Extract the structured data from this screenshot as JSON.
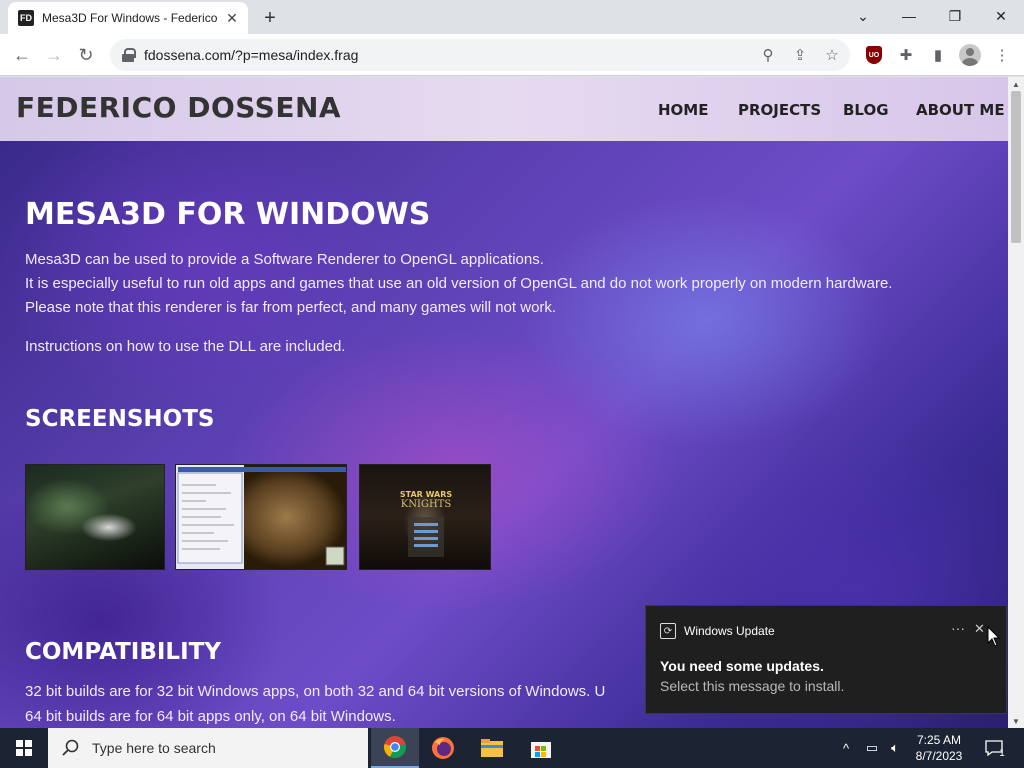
{
  "browser": {
    "tab_title": "Mesa3D For Windows - Federico",
    "favicon_text": "FD",
    "url": "fdossena.com/?p=mesa/index.frag",
    "ublock_text": "UO"
  },
  "site": {
    "logo": "FEDERICO DOSSENA",
    "nav": [
      "HOME",
      "PROJECTS",
      "BLOG",
      "ABOUT ME"
    ],
    "heading": "MESA3D FOR WINDOWS",
    "intro": [
      "Mesa3D can be used to provide a Software Renderer to OpenGL applications.",
      "It is especially useful to run old apps and games that use an old version of OpenGL and do not work properly on modern hardware.",
      "Please note that this renderer is far from perfect, and many games will not work."
    ],
    "instructions": "Instructions on how to use the DLL are included.",
    "screenshots_heading": "SCREENSHOTS",
    "compat_heading": "COMPATIBILITY",
    "compat_lines": [
      "32 bit builds are for 32 bit Windows apps, on both 32 and 64 bit versions of Windows. U",
      "64 bit builds are for 64 bit apps only, on 64 bit Windows."
    ]
  },
  "toast": {
    "app": "Windows Update",
    "title": "You need some updates.",
    "body": "Select this message to install."
  },
  "taskbar": {
    "search_placeholder": "Type here to search",
    "time": "7:25 AM",
    "date": "8/7/2023",
    "notification_count": "1"
  },
  "colors": {
    "page_header": "#e2d6f0",
    "hero_dark": "#2a1f70",
    "hero_mid": "#6e4cc8",
    "toast_bg": "#1f1f1f",
    "taskbar_bg": "#1c2333"
  }
}
